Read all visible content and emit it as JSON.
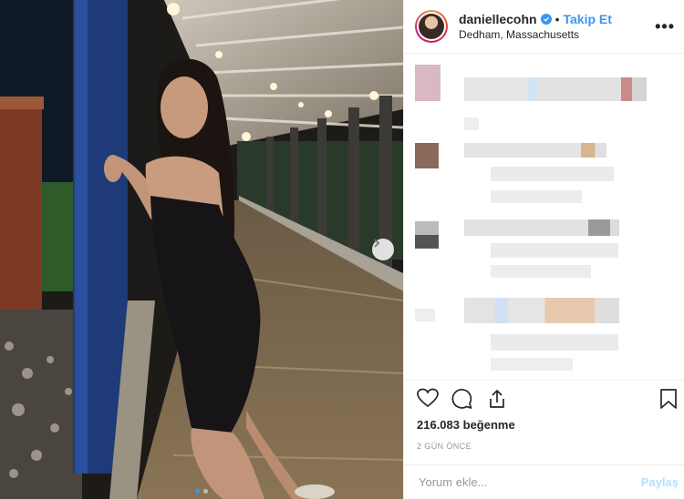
{
  "post": {
    "username": "daniellecohn",
    "verified": true,
    "bullet": "•",
    "follow_label": "Takip Et",
    "location": "Dedham, Massachusetts",
    "more_icon": "more-options-icon",
    "more_label": "•••"
  },
  "photo": {
    "carousel_dots": 2,
    "active_dot": 0
  },
  "actions": {
    "like_icon": "heart-icon",
    "comment_icon": "comment-icon",
    "share_icon": "share-icon",
    "save_icon": "bookmark-icon"
  },
  "stats": {
    "likes_count": "216.083",
    "likes_label": "beğenme",
    "time_ago": "2 GÜN ÖNCE"
  },
  "comment_box": {
    "placeholder": "Yorum ekle...",
    "post_label": "Paylaş"
  },
  "colors": {
    "accent": "#3897f0",
    "text": "#262626",
    "muted": "#999999"
  }
}
